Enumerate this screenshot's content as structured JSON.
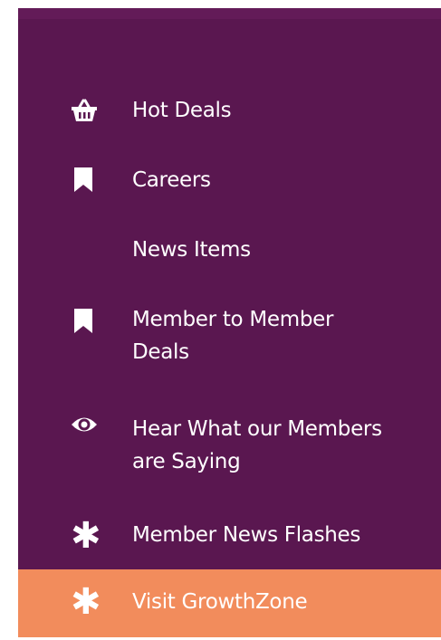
{
  "menu": {
    "items": [
      {
        "label": "Hot Deals",
        "icon": "basket-icon"
      },
      {
        "label": "Careers",
        "icon": "bookmark-icon"
      },
      {
        "label": "News Items",
        "icon": ""
      },
      {
        "label": "Member to Member Deals",
        "icon": "bookmark-icon"
      },
      {
        "label": "Hear What our Members are Saying",
        "icon": "eye-icon"
      },
      {
        "label": "Member News Flashes",
        "icon": "asterisk-icon"
      },
      {
        "label": "Visit GrowthZone",
        "icon": "asterisk-icon",
        "highlighted": true
      }
    ]
  },
  "colors": {
    "menu_background": "#5a1750",
    "highlight_background": "#f28c5c",
    "text": "#ffffff"
  }
}
